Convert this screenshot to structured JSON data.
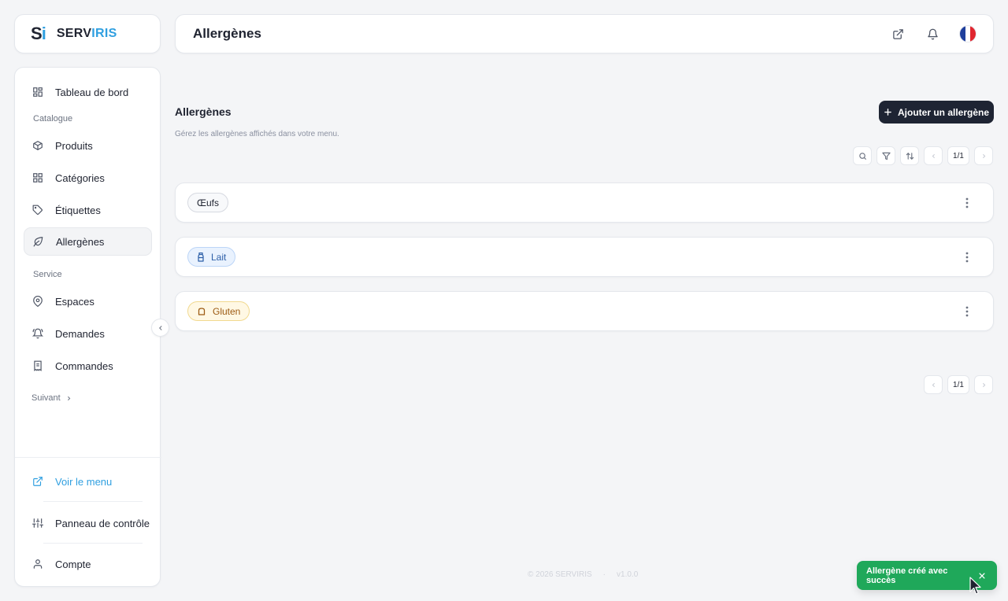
{
  "brand": {
    "mark_s": "S",
    "mark_i": "i",
    "name_a": "SERV",
    "name_b": "IRIS"
  },
  "header": {
    "title": "Allergènes"
  },
  "sidebar": {
    "items": [
      {
        "label": "Tableau de bord"
      },
      {
        "label": "Produits"
      },
      {
        "label": "Catégories"
      },
      {
        "label": "Étiquettes"
      },
      {
        "label": "Allergènes"
      },
      {
        "label": "Espaces"
      },
      {
        "label": "Demandes"
      },
      {
        "label": "Commandes"
      }
    ],
    "sections": {
      "catalogue": "Catalogue",
      "service": "Service"
    },
    "more": "Suivant",
    "bottom": {
      "view_menu": "Voir le menu",
      "control_panel": "Panneau de contrôle",
      "account": "Compte"
    }
  },
  "main": {
    "title": "Allergènes",
    "subtitle": "Gérez les allergènes affichés dans votre menu.",
    "add_button": "Ajouter un allergène",
    "pagination": "1/1",
    "items": [
      {
        "label": "Œufs",
        "color": "neutral"
      },
      {
        "label": "Lait",
        "color": "blue",
        "icon": "bottle-icon"
      },
      {
        "label": "Gluten",
        "color": "amber",
        "icon": "bread-icon"
      }
    ]
  },
  "footer": {
    "copyright": "© 2026 SERVIRIS",
    "separator": "·",
    "version": "v1.0.0"
  },
  "toast": {
    "message": "Allergène créé avec succès",
    "color": "#1fa85a"
  },
  "colors": {
    "accent": "#2f9fe0",
    "primary_button": "#1e2433"
  }
}
